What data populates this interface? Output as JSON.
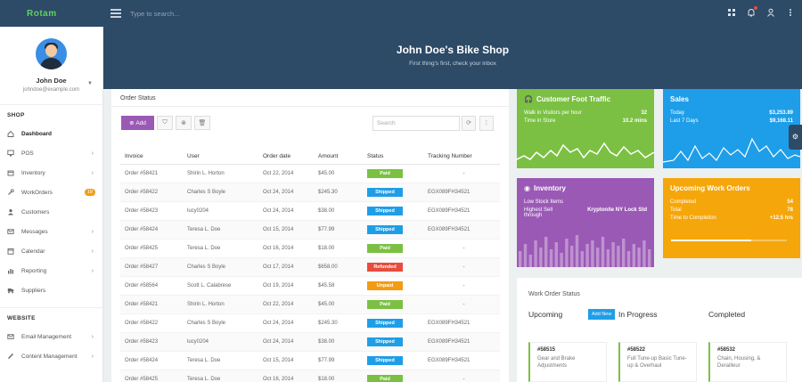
{
  "topbar": {
    "brand": "Rotam",
    "search_placeholder": "Type to search..."
  },
  "profile": {
    "name": "John Doe",
    "email": "johndoe@example.com"
  },
  "sidebar": {
    "shop_title": "SHOP",
    "shop_items": [
      {
        "label": "Dashboard",
        "icon": "home-icon"
      },
      {
        "label": "POS",
        "icon": "monitor-icon"
      },
      {
        "label": "Inventory",
        "icon": "box-icon"
      },
      {
        "label": "WorkOrders",
        "icon": "wrench-icon",
        "badge": "18"
      },
      {
        "label": "Customers",
        "icon": "user-icon"
      },
      {
        "label": "Messages",
        "icon": "envelope-icon"
      },
      {
        "label": "Calendar",
        "icon": "calendar-icon"
      },
      {
        "label": "Reporting",
        "icon": "chart-icon"
      },
      {
        "label": "Suppliers",
        "icon": "truck-icon"
      }
    ],
    "website_title": "WEBSITE",
    "website_items": [
      {
        "label": "Email Management",
        "icon": "mail-icon"
      },
      {
        "label": "Content Management",
        "icon": "pencil-icon"
      }
    ]
  },
  "banner": {
    "title": "John Doe's Bike Shop",
    "subtitle": "First thing's first, check your inbox"
  },
  "orders": {
    "panel_title": "Order Status",
    "add_label": "Add",
    "search_placeholder": "Search",
    "columns": [
      "Invoice",
      "User",
      "Order date",
      "Amount",
      "Status",
      "Tracking Number"
    ],
    "rows": [
      {
        "invoice": "Order #58421",
        "user": "Shirin L. Horton",
        "date": "Oct 22, 2014",
        "amount": "$45.00",
        "status": "Paid",
        "tracking": "-"
      },
      {
        "invoice": "Order #58422",
        "user": "Charles S Boyle",
        "date": "Oct 24, 2014",
        "amount": "$245.30",
        "status": "Shipped",
        "tracking": "EGX089FH34521"
      },
      {
        "invoice": "Order #58423",
        "user": "lucy0204",
        "date": "Oct 24, 2014",
        "amount": "$38.00",
        "status": "Shipped",
        "tracking": "EGX089FH34521"
      },
      {
        "invoice": "Order #58424",
        "user": "Teresa L. Doe",
        "date": "Oct 15, 2014",
        "amount": "$77.99",
        "status": "Shipped",
        "tracking": "EGX089FH34521"
      },
      {
        "invoice": "Order #58425",
        "user": "Teresa L. Doe",
        "date": "Oct 16, 2014",
        "amount": "$18.00",
        "status": "Paid",
        "tracking": "-"
      },
      {
        "invoice": "Order #58427",
        "user": "Charles S Boyle",
        "date": "Oct 17, 2014",
        "amount": "$658.00",
        "status": "Refunded",
        "tracking": "-"
      },
      {
        "invoice": "Order #58564",
        "user": "Scott L. Calabrese",
        "date": "Oct 19, 2014",
        "amount": "$45.58",
        "status": "Unpaid",
        "tracking": "-"
      },
      {
        "invoice": "Order #58421",
        "user": "Shirin L. Horton",
        "date": "Oct 22, 2014",
        "amount": "$45.00",
        "status": "Paid",
        "tracking": "-"
      },
      {
        "invoice": "Order #58422",
        "user": "Charles S Boyle",
        "date": "Oct 24, 2014",
        "amount": "$245.30",
        "status": "Shipped",
        "tracking": "EGX089FH34521"
      },
      {
        "invoice": "Order #58423",
        "user": "lucy0204",
        "date": "Oct 24, 2014",
        "amount": "$38.00",
        "status": "Shipped",
        "tracking": "EGX089FH34521"
      },
      {
        "invoice": "Order #58424",
        "user": "Teresa L. Doe",
        "date": "Oct 15, 2014",
        "amount": "$77.99",
        "status": "Shipped",
        "tracking": "EGX089FH34521"
      },
      {
        "invoice": "Order #58425",
        "user": "Teresa L. Doe",
        "date": "Oct 16, 2014",
        "amount": "$18.00",
        "status": "Paid",
        "tracking": "-"
      }
    ]
  },
  "tiles": {
    "traffic": {
      "title": "Customer Foot Traffic",
      "r1": "Walk in Visitors per hour",
      "r1v": "32",
      "r2": "Time in Store",
      "r2v": "10.2 mins",
      "color": "#7bc043"
    },
    "sales": {
      "title": "Sales",
      "r1": "Today",
      "r1v": "$3,253.89",
      "r2": "Last 7 Days",
      "r2v": "$9,168.11",
      "color": "#1e9ee8"
    },
    "inventory": {
      "title": "Inventory",
      "r1": "Low Stock Items",
      "r1v": "",
      "r2": "Highest Sell through",
      "r2v": "Kryptonite NY Lock Std",
      "color": "#9b59b6"
    },
    "workorders": {
      "title": "Upcoming Work Orders",
      "r1": "Completed",
      "r1v": "54",
      "r2": "Total",
      "r2v": "78",
      "r3": "Time to Completion",
      "r3v": "+12.5 hrs",
      "progress": 0.69,
      "color": "#f5a60a"
    }
  },
  "work_order_status": {
    "title": "Work Order Status",
    "col1": "Upcoming",
    "col1_btn": "Add New",
    "col2": "In Progress",
    "col3": "Completed",
    "cards": [
      {
        "num": "#58515",
        "desc": "Gear and Brake Adjustments"
      },
      {
        "num": "#58522",
        "desc": "Full Tune-up Basic Tune-up & Overhaul"
      },
      {
        "num": "#58532",
        "desc": "Chain, Housing, & Derailleur"
      }
    ]
  }
}
